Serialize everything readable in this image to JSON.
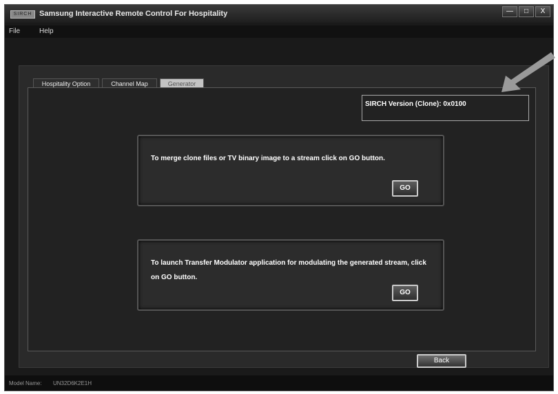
{
  "window": {
    "icon_text": "SIRCH",
    "title": "Samsung Interactive Remote Control For Hospitality",
    "controls": {
      "minimize": "—",
      "maximize": "□",
      "close": "X"
    }
  },
  "menu": {
    "items": [
      {
        "label": "File"
      },
      {
        "label": "Help"
      }
    ]
  },
  "tabs": [
    {
      "label": "Hospitality Option"
    },
    {
      "label": "Channel Map"
    },
    {
      "label": "Generator",
      "active": true
    }
  ],
  "version": {
    "text": "SIRCH Version (Clone): 0x0100"
  },
  "actions": [
    {
      "text": "To merge clone files or TV binary image to a stream click on GO button.",
      "button": "GO"
    },
    {
      "text": "To launch Transfer Modulator application for modulating the generated stream, click on GO button.",
      "button": "GO"
    }
  ],
  "footer": {
    "back_label": "Back"
  },
  "status": {
    "model_label": "Model Name:",
    "model_value": "UN32D6K2E1H"
  },
  "colors": {
    "window_bg": "#1a1a1a",
    "panel_bg": "#222222",
    "active_tab": "#c4c4c4",
    "annotation_arrow": "#9a9a9a"
  },
  "icons": {
    "annotation": "arrow-pointer-icon"
  }
}
